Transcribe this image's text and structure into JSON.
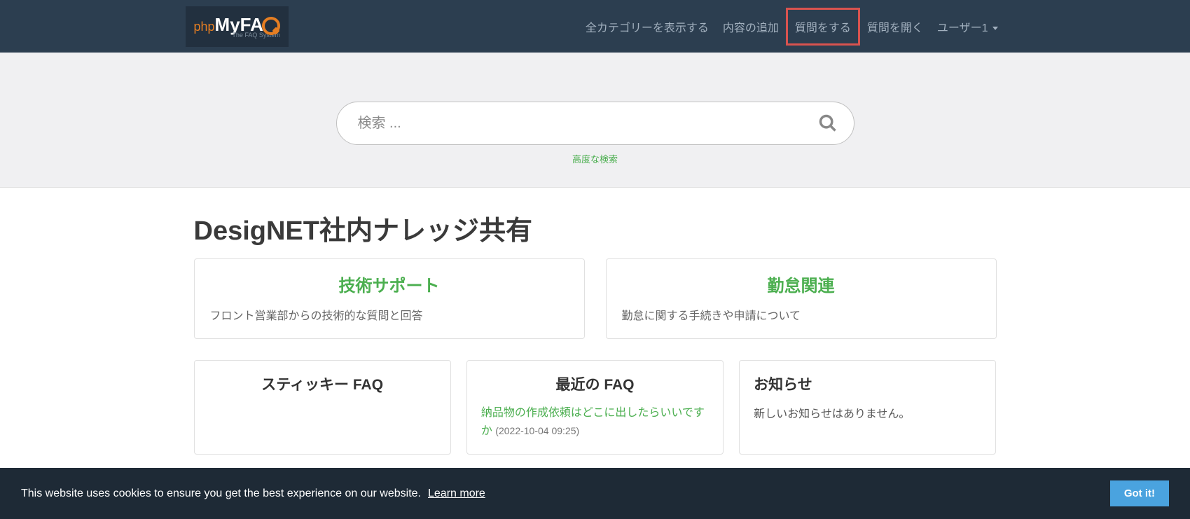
{
  "logo": {
    "prefix": "php",
    "main": "MyFA",
    "subtitle": "The FAQ System"
  },
  "nav": {
    "show_all": "全カテゴリーを表示する",
    "add_content": "内容の追加",
    "ask_question": "質問をする",
    "open_question": "質問を開く",
    "user": "ユーザー1"
  },
  "search": {
    "placeholder": "検索 ...",
    "advanced": "高度な検索"
  },
  "page_title": "DesigNET社内ナレッジ共有",
  "categories": [
    {
      "title": "技術サポート",
      "desc": "フロント営業部からの技術的な質問と回答"
    },
    {
      "title": "勤怠関連",
      "desc": "勤怠に関する手続きや申請について"
    }
  ],
  "widgets": {
    "sticky": {
      "title": "スティッキー FAQ"
    },
    "recent": {
      "title": "最近の FAQ",
      "item_text": "納品物の作成依頼はどこに出したらいいですか",
      "item_date": "(2022-10-04 09:25)"
    },
    "news": {
      "title": "お知らせ",
      "empty": "新しいお知らせはありません。"
    }
  },
  "cookie": {
    "message": "This website uses cookies to ensure you get the best experience on our website.",
    "learn": "Learn more",
    "button": "Got it!"
  }
}
